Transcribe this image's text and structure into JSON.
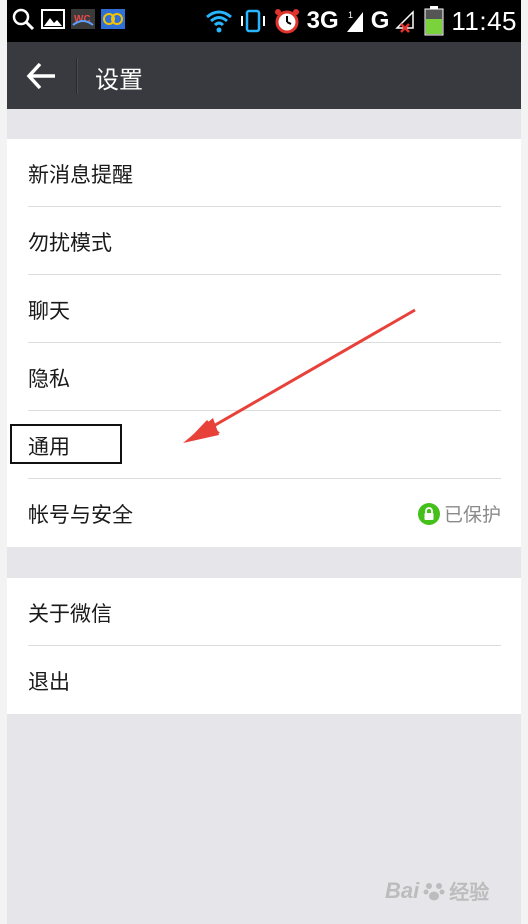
{
  "status_bar": {
    "network_label": "3G",
    "network_label_2": "G",
    "time": "11:45"
  },
  "header": {
    "title": "设置"
  },
  "settings": {
    "group1": [
      {
        "label": "新消息提醒"
      },
      {
        "label": "勿扰模式"
      },
      {
        "label": "聊天"
      },
      {
        "label": "隐私"
      },
      {
        "label": "通用"
      },
      {
        "label": "帐号与安全",
        "status": "已保护"
      }
    ],
    "group2": [
      {
        "label": "关于微信"
      },
      {
        "label": "退出"
      }
    ]
  },
  "colors": {
    "titlebar": "#393a3f",
    "background": "#e6e6ea",
    "accent_green": "#45c01a",
    "arrow_red": "#e8413a"
  },
  "watermark": {
    "text": "Bai",
    "text2": "经验"
  }
}
